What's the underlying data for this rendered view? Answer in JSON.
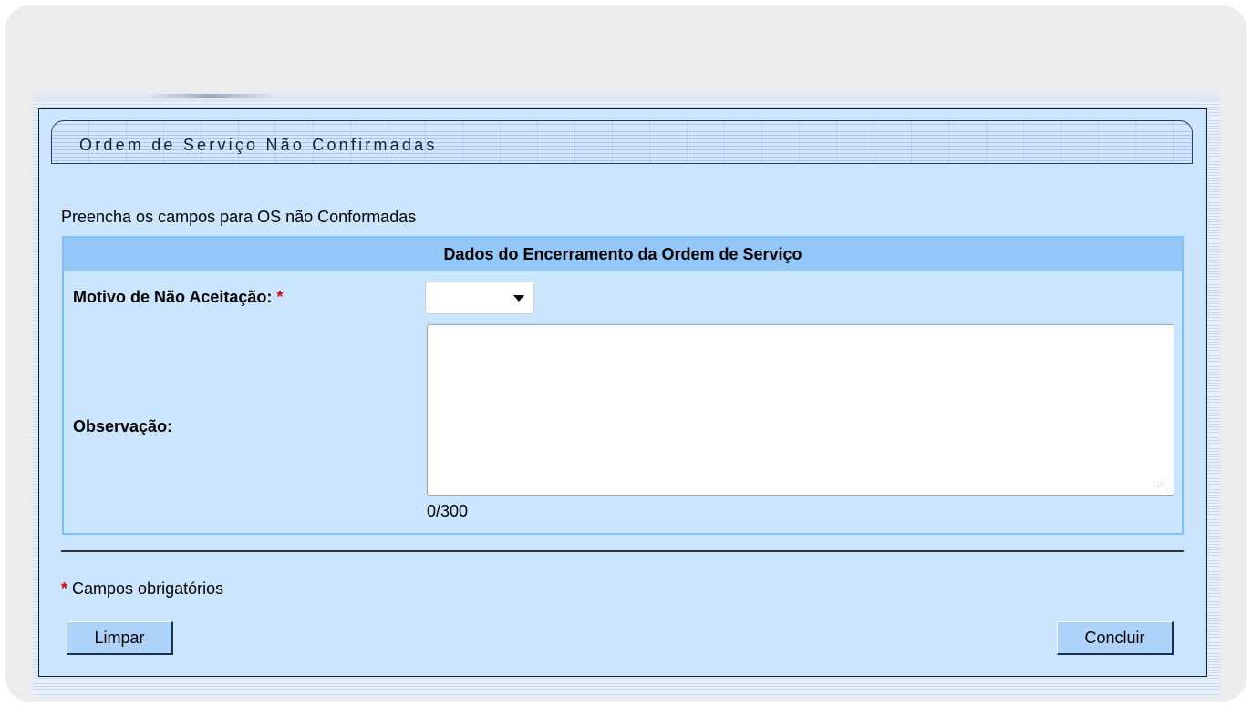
{
  "form": {
    "title": "Ordem de Serviço Não Confirmadas",
    "intro": "Preencha os campos para OS não Conformadas",
    "section_header": "Dados do Encerramento da Ordem de Serviço",
    "motivo_label": "Motivo de Não Aceitação:",
    "required_marker": "*",
    "motivo_selected": "",
    "observacao_label": "Observação:",
    "observacao_value": "",
    "char_counter": "0/300",
    "required_legend": "Campos obrigatórios",
    "clear_button": "Limpar",
    "submit_button": "Concluir"
  },
  "icons": {
    "select_caret": "chevron-down-icon",
    "textarea_grip": "resize-grip-icon"
  },
  "colors": {
    "panel_bg": "#cbe5ff",
    "section_header_bg": "#93c7f7",
    "button_bg": "#aed3fb",
    "required": "#e00000"
  }
}
